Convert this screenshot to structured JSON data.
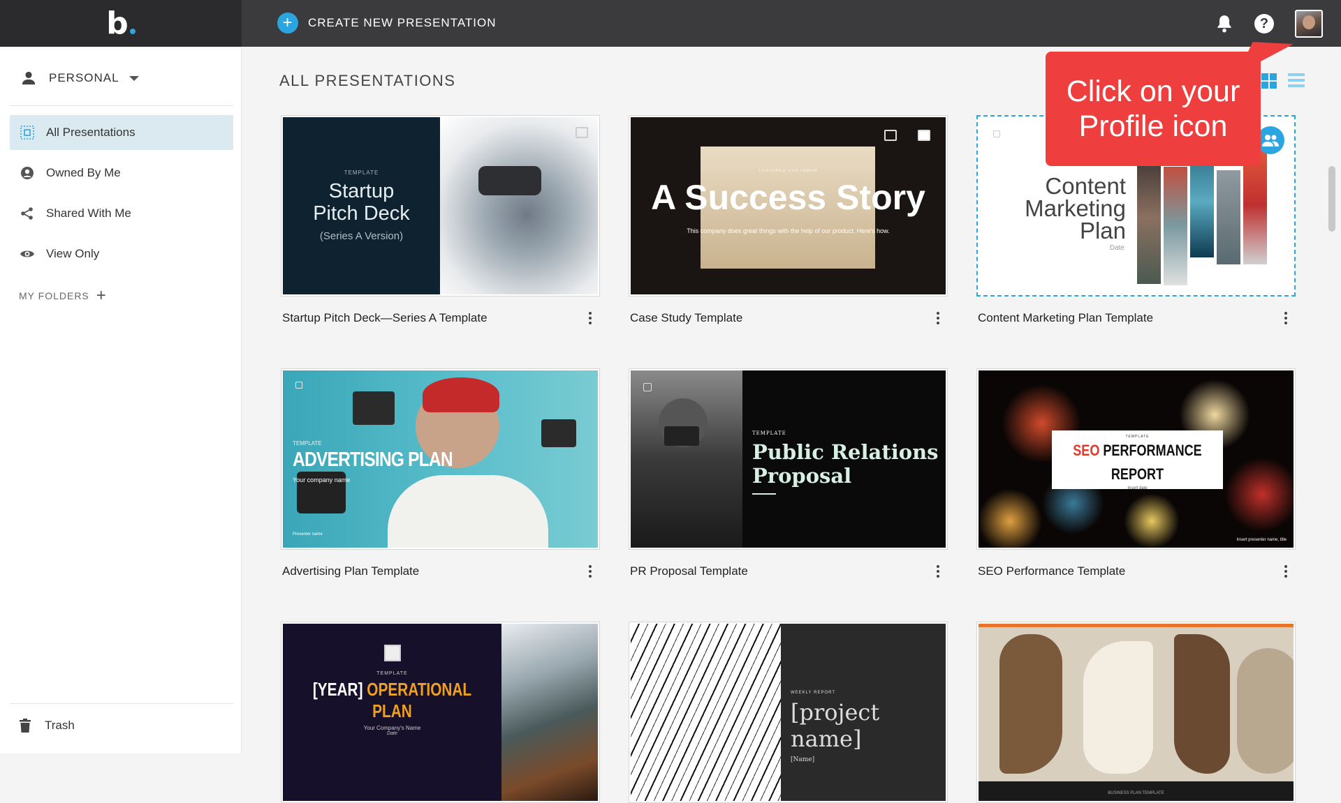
{
  "brand": {
    "logo_text": "b"
  },
  "topbar": {
    "create_label": "CREATE NEW PRESENTATION"
  },
  "sidebar": {
    "workspace": "PERSONAL",
    "items": [
      {
        "label": "All Presentations",
        "icon": "grid-icon",
        "active": true
      },
      {
        "label": "Owned By Me",
        "icon": "user-circle-icon"
      },
      {
        "label": "Shared With Me",
        "icon": "share-icon"
      },
      {
        "label": "View Only",
        "icon": "eye-icon"
      }
    ],
    "folders_label": "MY FOLDERS",
    "trash_label": "Trash"
  },
  "main": {
    "heading": "ALL PRESENTATIONS"
  },
  "callout": {
    "text": "Click on your Profile icon"
  },
  "cards": [
    {
      "title": "Startup Pitch Deck—Series A Template",
      "slide": {
        "tag": "TEMPLATE",
        "line1": "Startup",
        "line2": "Pitch Deck",
        "line3": "(Series A Version)"
      }
    },
    {
      "title": "Case Study Template",
      "slide": {
        "tag": "FEATURED CUSTOMER",
        "headline": "A Success Story",
        "sub": "This company does great things with the help of our product. Here's how."
      }
    },
    {
      "title": "Content Marketing Plan Template",
      "slide": {
        "line1": "Content",
        "line2": "Marketing",
        "line3": "Plan",
        "date": "Date"
      }
    },
    {
      "title": "Advertising Plan Template",
      "slide": {
        "tag": "TEMPLATE",
        "headline": "ADVERTISING PLAN",
        "sub": "Your company name",
        "presenter": "Presenter name"
      }
    },
    {
      "title": "PR Proposal Template",
      "slide": {
        "tag": "TEMPLATE",
        "line1": "Public Relations",
        "line2": "Proposal"
      }
    },
    {
      "title": "SEO Performance Template",
      "slide": {
        "tag": "TEMPLATE",
        "headline_a": "SEO",
        "headline_b": "PERFORMANCE REPORT",
        "sub": "Insert date",
        "footer": "Insert presenter name, title"
      }
    },
    {
      "title": "",
      "slide": {
        "tag": "TEMPLATE",
        "headline_a": "[YEAR]",
        "headline_b": "OPERATIONAL PLAN",
        "sub": "Your Company's Name",
        "date": "Date"
      }
    },
    {
      "title": "",
      "slide": {
        "tag": "WEEKLY REPORT",
        "headline": "[project name]",
        "sub": "[Name]"
      }
    },
    {
      "title": "",
      "slide": {
        "footer": "BUSINESS PLAN TEMPLATE"
      }
    }
  ],
  "colors": {
    "accent": "#2aa5e0",
    "callout": "#ee3e3e",
    "topbar": "#3b3b3d"
  }
}
